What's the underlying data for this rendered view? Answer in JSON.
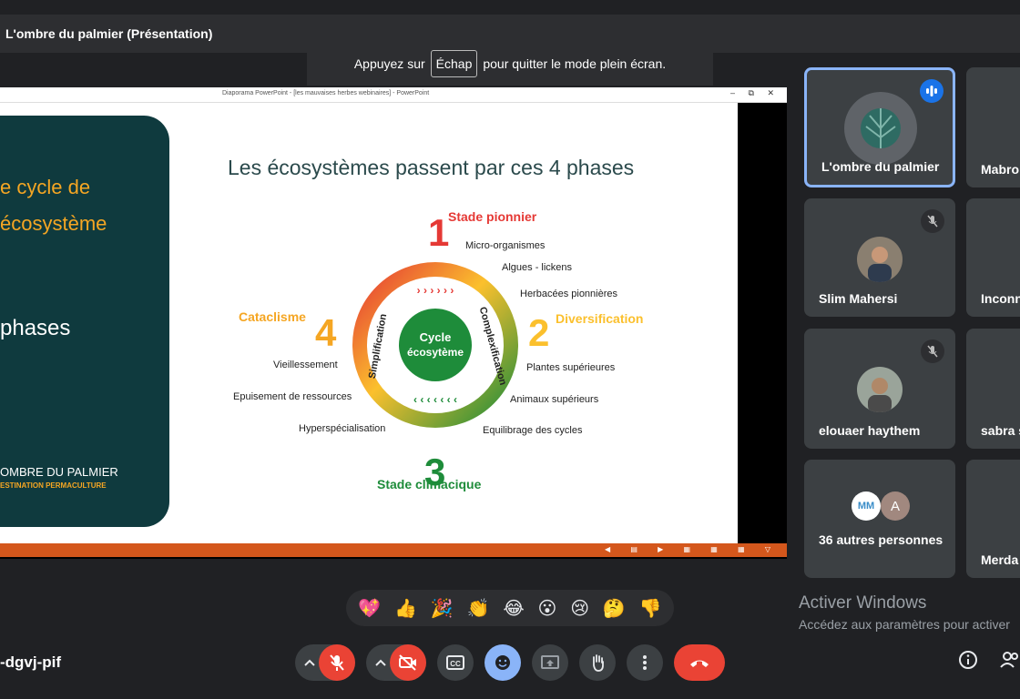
{
  "window": {
    "title": "L'ombre du palmier (Présentation)"
  },
  "fullscreen_banner": {
    "before": "Appuyez sur",
    "key": "Échap",
    "after": "pour quitter le mode plein écran."
  },
  "presentation": {
    "app_title": "Diaporama PowerPoint - [les mauvaises herbes webinaires] - PowerPoint",
    "window_controls": "– ⧉ ✕",
    "slide": {
      "left_panel": {
        "line1": "e cycle de",
        "line2": "écosystème",
        "line3": "phases",
        "logo_line1": "OMBRE DU PALMIER",
        "logo_line2": "ESTINATION PERMACULTURE"
      },
      "title": "Les écosystèmes passent par ces 4 phases",
      "center_line1": "Cycle",
      "center_line2": "écosytème",
      "arc_left": "Simplification",
      "arc_right": "Complexification",
      "phase1_num": "1",
      "phase1_label": "Stade pionnier",
      "phase1_items": [
        "Micro-organismes",
        "Algues - lickens",
        "Herbacées pionnières"
      ],
      "phase2_num": "2",
      "phase2_label": "Diversification",
      "phase2_items": [
        "Plantes supérieures",
        "Animaux supérieurs",
        "Equilibrage des cycles"
      ],
      "phase3_num": "3",
      "phase3_label": "Stade climacique",
      "phase4_num": "4",
      "phase4_label": "Cataclisme",
      "phase4_items": [
        "Vieillessement",
        "Epuisement de ressources",
        "Hyperspécialisation"
      ],
      "arrows_top": "› › ›   › › ›",
      "arrows_bottom": "‹ ‹ ‹ ‹      ‹ ‹ ‹"
    },
    "status_icons": "◀ ▤ ▶ ▦ ▦ ▦ ▽"
  },
  "participants": [
    {
      "name": "L'ombre du palmier",
      "speaking": true
    },
    {
      "name": "Mabro"
    },
    {
      "name": "Slim Mahersi",
      "muted": true
    },
    {
      "name": "Inconn"
    },
    {
      "name": "elouaer haythem",
      "muted": true
    },
    {
      "name": "sabra s"
    },
    {
      "name": "36 autres personnes",
      "avatar_initial": "A",
      "avatar_logo": "MM"
    },
    {
      "name": "Merda"
    }
  ],
  "reactions": [
    "💖",
    "👍",
    "🎉",
    "👏",
    "😂",
    "😮",
    "😢",
    "🤔",
    "👎"
  ],
  "watermark": {
    "line1": "Activer Windows",
    "line2": "Accédez aux paramètres pour activer"
  },
  "meeting_code": "-dgvj-pif",
  "colors": {
    "accent_blue": "#8ab4f8",
    "end_call_red": "#ea4335",
    "orange": "#f5a623",
    "green": "#1e8c3a",
    "red": "#e53935"
  }
}
